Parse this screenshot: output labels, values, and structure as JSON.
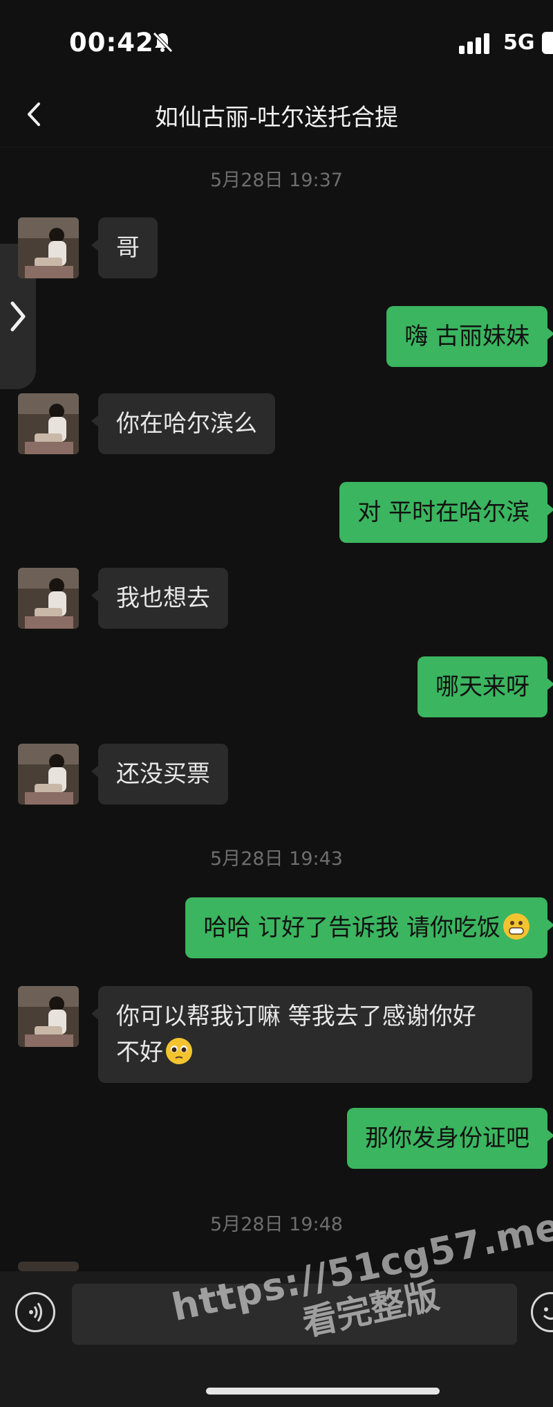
{
  "status_bar": {
    "time": "00:42",
    "network": "5G"
  },
  "header": {
    "title": "如仙古丽-吐尔送托合提"
  },
  "timestamps": [
    "5月28日 19:37",
    "5月28日 19:43",
    "5月28日 19:48"
  ],
  "messages": [
    {
      "side": "in",
      "text": "哥"
    },
    {
      "side": "out",
      "text": "嗨 古丽妹妹"
    },
    {
      "side": "in",
      "text": "你在哈尔滨么"
    },
    {
      "side": "out",
      "text": "对 平时在哈尔滨"
    },
    {
      "side": "in",
      "text": "我也想去"
    },
    {
      "side": "out",
      "text": "哪天来呀"
    },
    {
      "side": "in",
      "text": "还没买票"
    },
    {
      "side": "out",
      "text": "哈哈 订好了告诉我 请你吃饭",
      "emoji": "grinning-face"
    },
    {
      "side": "in",
      "text_line1": "你可以帮我订嘛 等我去了感谢你好",
      "text_line2": "不好",
      "emoji": "pleading-face"
    },
    {
      "side": "out",
      "text": "那你发身份证吧"
    }
  ],
  "watermark": {
    "url": "https://51cg57.me",
    "text": "看完整版"
  },
  "colors": {
    "background": "#111111",
    "outgoing_bubble": "#3bb55f",
    "incoming_bubble": "#2b2b2b"
  }
}
